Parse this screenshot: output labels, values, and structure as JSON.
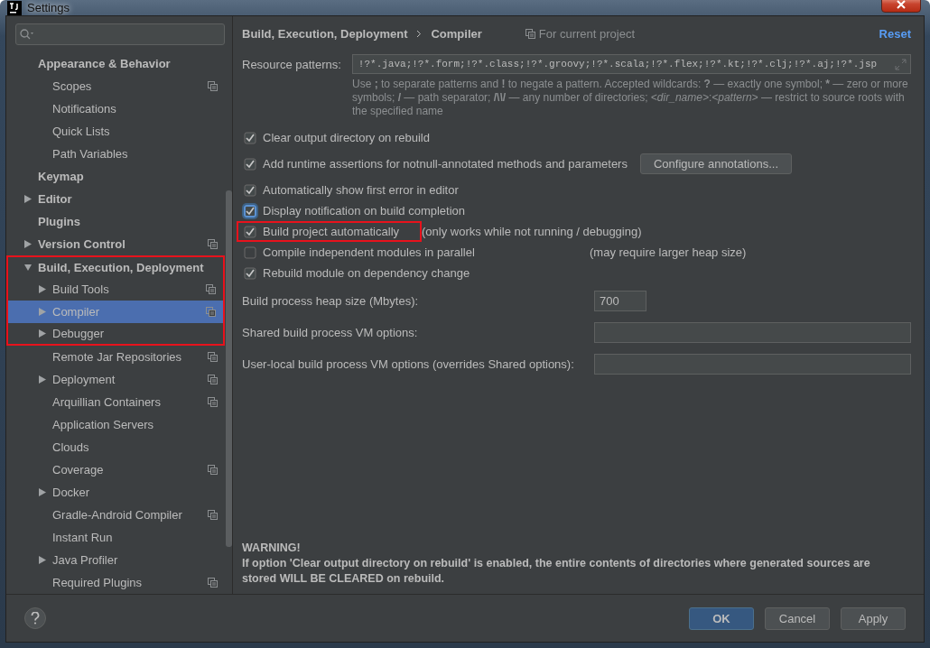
{
  "window": {
    "title": "Settings"
  },
  "sidebar": {
    "items": [
      {
        "label": "Appearance & Behavior",
        "selected": false,
        "shared": false,
        "highlighted": false,
        "children": [
          {
            "label": "Scopes",
            "selected": false,
            "shared": true,
            "highlighted": false
          },
          {
            "label": "Notifications",
            "selected": false,
            "shared": false,
            "highlighted": false
          },
          {
            "label": "Quick Lists",
            "selected": false,
            "shared": false,
            "highlighted": false
          },
          {
            "label": "Path Variables",
            "selected": false,
            "shared": false,
            "highlighted": false
          }
        ]
      },
      {
        "label": "Keymap",
        "selected": false,
        "shared": false,
        "highlighted": false
      },
      {
        "label": "Editor",
        "expanded": false,
        "selected": false,
        "shared": false,
        "highlighted": false
      },
      {
        "label": "Plugins",
        "selected": false,
        "shared": false,
        "highlighted": false
      },
      {
        "label": "Version Control",
        "expanded": false,
        "selected": false,
        "shared": true,
        "highlighted": false
      },
      {
        "label": "Build, Execution, Deployment",
        "expanded": true,
        "selected": false,
        "shared": false,
        "highlighted": true,
        "children": [
          {
            "label": "Build Tools",
            "expanded": false,
            "selected": false,
            "shared": true,
            "highlighted": true
          },
          {
            "label": "Compiler",
            "expanded": false,
            "selected": true,
            "shared": true,
            "highlighted": true
          },
          {
            "label": "Debugger",
            "expanded": false,
            "selected": false,
            "shared": false,
            "highlighted": true
          },
          {
            "label": "Remote Jar Repositories",
            "selected": false,
            "shared": true,
            "highlighted": false
          },
          {
            "label": "Deployment",
            "expanded": false,
            "selected": false,
            "shared": true,
            "highlighted": false
          },
          {
            "label": "Arquillian Containers",
            "selected": false,
            "shared": true,
            "highlighted": false
          },
          {
            "label": "Application Servers",
            "selected": false,
            "shared": false,
            "highlighted": false
          },
          {
            "label": "Clouds",
            "selected": false,
            "shared": false,
            "highlighted": false
          },
          {
            "label": "Coverage",
            "selected": false,
            "shared": true,
            "highlighted": false
          },
          {
            "label": "Docker",
            "expanded": false,
            "selected": false,
            "shared": false,
            "highlighted": false
          },
          {
            "label": "Gradle-Android Compiler",
            "selected": false,
            "shared": true,
            "highlighted": false
          },
          {
            "label": "Instant Run",
            "selected": false,
            "shared": false,
            "highlighted": false
          },
          {
            "label": "Java Profiler",
            "expanded": false,
            "selected": false,
            "shared": false,
            "highlighted": false
          },
          {
            "label": "Required Plugins",
            "selected": false,
            "shared": true,
            "highlighted": false
          }
        ]
      }
    ]
  },
  "breadcrumb": [
    "Build, Execution, Deployment",
    "Compiler"
  ],
  "scope_label": "For current project",
  "reset_link": "Reset",
  "resource_patterns": {
    "label": "Resource patterns:",
    "value": "!?*.java;!?*.form;!?*.class;!?*.groovy;!?*.scala;!?*.flex;!?*.kt;!?*.clj;!?*.aj;!?*.jsp"
  },
  "hint": "Use **;** to separate patterns and **!** to negate a pattern. Accepted wildcards: **?** — exactly one symbol; ***** — zero or more symbols; **/** — path separator; **/\\*\\*/** — any number of directories; *<dir_name>*:*<pattern>* — restrict to source roots with the specified name",
  "options": [
    {
      "label": "Clear output directory on rebuild",
      "checked": true,
      "focused": false,
      "highlighted": false
    },
    {
      "label": "Add runtime assertions for notnull-annotated methods and parameters",
      "checked": true,
      "focused": false,
      "highlighted": false,
      "button": "Configure annotations..."
    },
    {
      "label": "Automatically show first error in editor",
      "checked": true,
      "focused": false,
      "highlighted": false
    },
    {
      "label": "Display notification on build completion",
      "checked": true,
      "focused": true,
      "highlighted": false
    },
    {
      "label": "Build project automatically",
      "checked": true,
      "focused": false,
      "highlighted": true,
      "note": "(only works while not running / debugging)"
    },
    {
      "label": "Compile independent modules in parallel",
      "checked": false,
      "focused": false,
      "highlighted": false,
      "note": "(may require larger heap size)"
    },
    {
      "label": "Rebuild module on dependency change",
      "checked": true,
      "focused": false,
      "highlighted": false
    }
  ],
  "fields": [
    {
      "label": "Build process heap size (Mbytes):",
      "value": "700",
      "kind": "short"
    },
    {
      "label": "Shared build process VM options:",
      "kind": "wide"
    },
    {
      "label": "User-local build process VM options (overrides Shared options):",
      "kind": "wide"
    }
  ],
  "warning": {
    "title": "WARNING!",
    "text": "If option 'Clear output directory on rebuild' is enabled, the entire contents of directories where generated sources are stored WILL BE CLEARED on rebuild."
  },
  "buttons": [
    {
      "label": "OK",
      "kind": "primary"
    },
    {
      "label": "Cancel",
      "kind": "normal"
    },
    {
      "label": "Apply",
      "kind": "normal"
    }
  ]
}
